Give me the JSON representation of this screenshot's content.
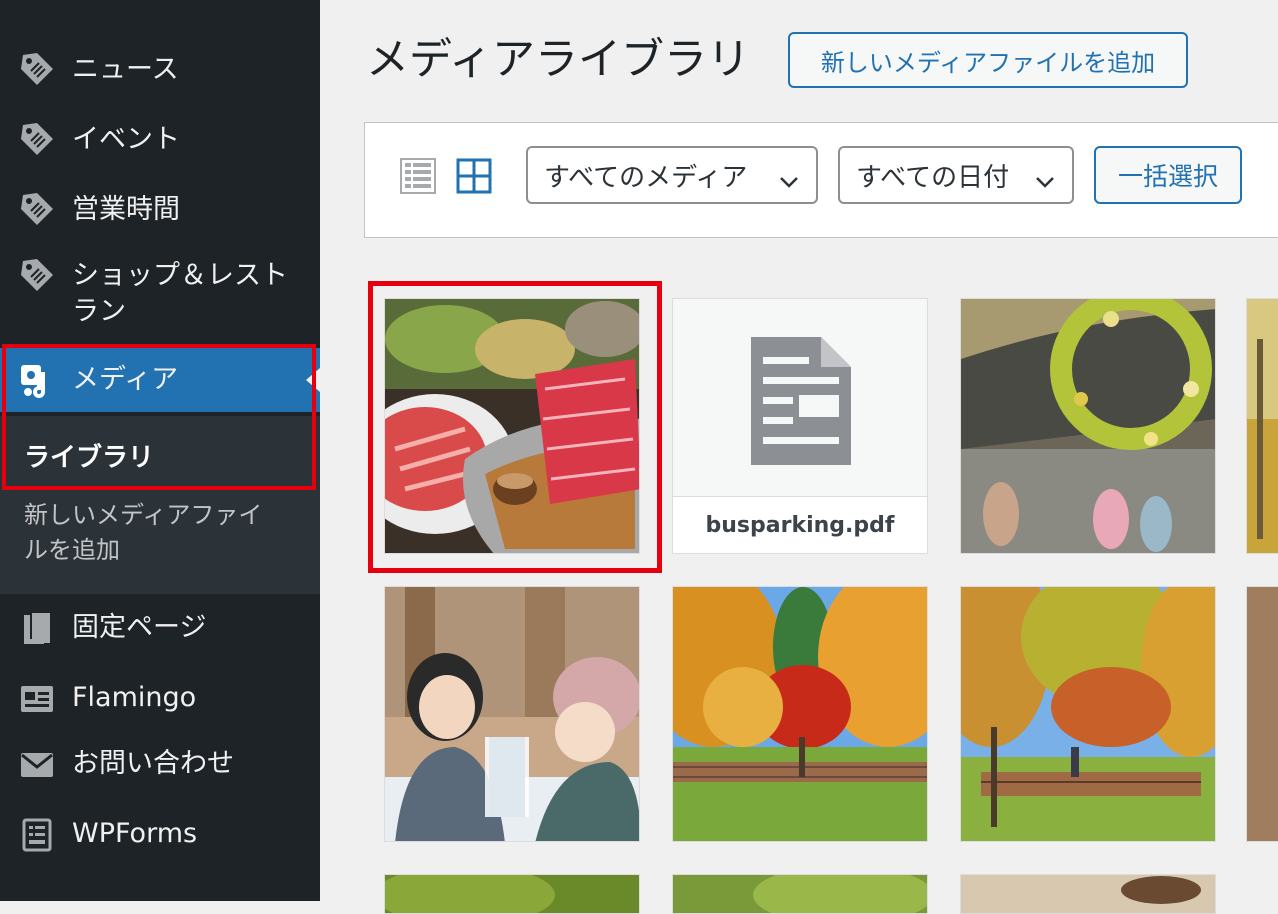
{
  "sidebar": {
    "items": [
      {
        "label": "ニュース",
        "icon": "tag-icon"
      },
      {
        "label": "イベント",
        "icon": "tag-icon"
      },
      {
        "label": "営業時間",
        "icon": "tag-icon"
      },
      {
        "label_line1": "ショップ＆レスト",
        "label_line2": "ラン",
        "icon": "tag-icon"
      },
      {
        "label": "メディア",
        "icon": "media-icon"
      },
      {
        "label": "固定ページ",
        "icon": "pages-icon"
      },
      {
        "label": "Flamingo",
        "icon": "flamingo-icon"
      },
      {
        "label": "お問い合わせ",
        "icon": "mail-icon"
      },
      {
        "label": "WPForms",
        "icon": "wpforms-icon"
      }
    ],
    "submenu": {
      "current": "ライブラリ",
      "other_line1": "新しいメディアファイ",
      "other_line2": "ルを追加"
    }
  },
  "header": {
    "title": "メディアライブラリ",
    "add_new_label": "新しいメディアファイルを追加"
  },
  "toolbar": {
    "filter_type": "すべてのメディア",
    "filter_date": "すべての日付",
    "bulk_select_label": "一括選択"
  },
  "media_grid": {
    "doc_file_name": "busparking.pdf",
    "items": [
      "photo-wagyu-shabu",
      "doc-busparking",
      "photo-wreath",
      "photo-partial",
      "photo-friends-ice",
      "photo-autumn-trees",
      "photo-autumn-bookshelf",
      "photo-partial-2"
    ]
  },
  "colors": {
    "sidebar_bg": "#1d2327",
    "accent": "#2271b1",
    "highlight": "#e6000e"
  }
}
